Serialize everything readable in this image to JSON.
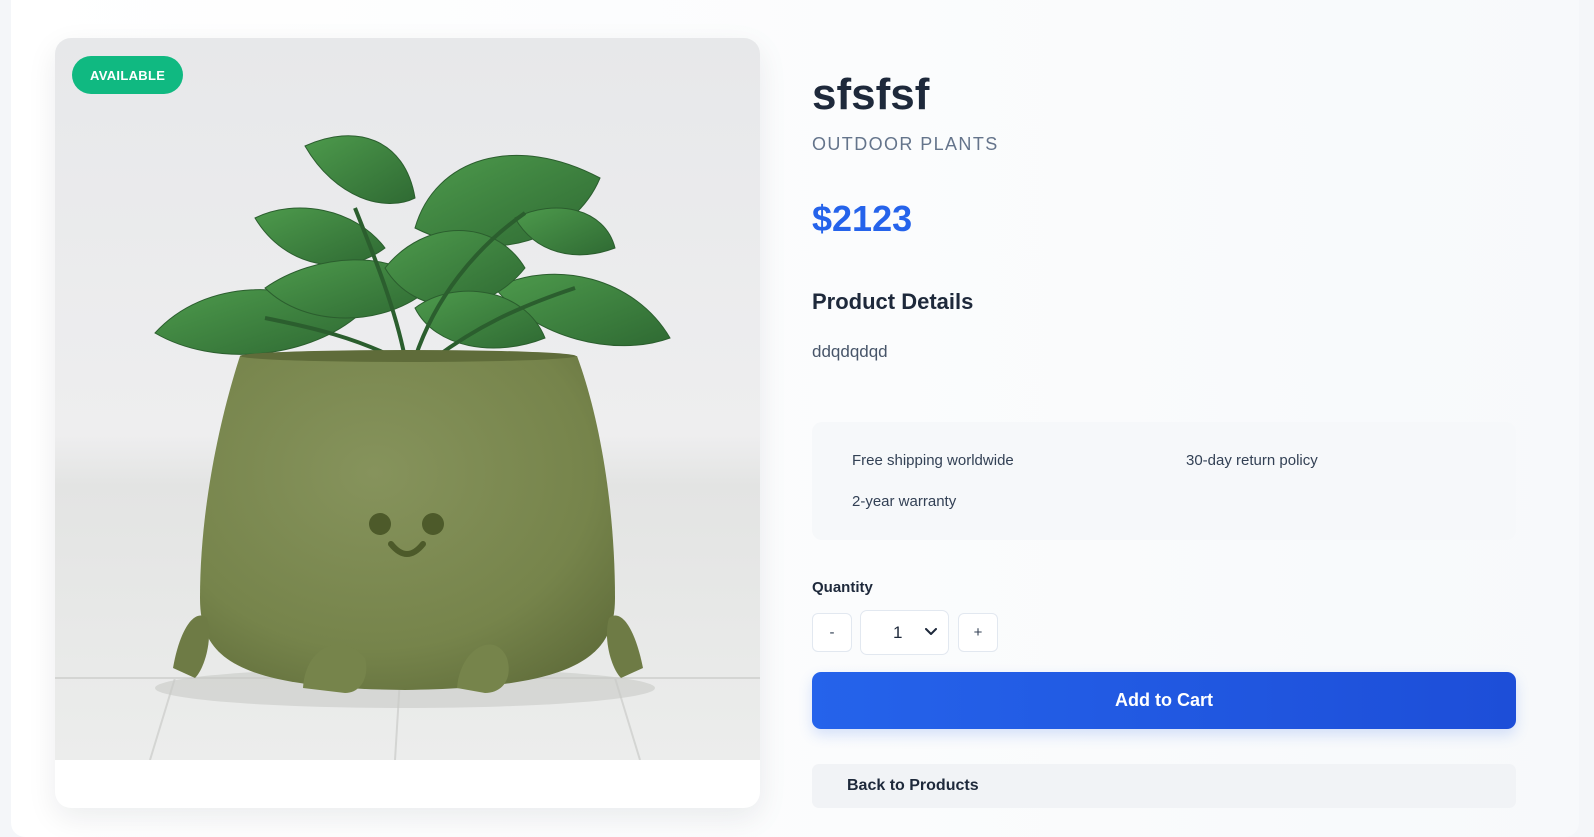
{
  "product": {
    "availability_badge": "AVAILABLE",
    "name": "sfsfsf",
    "category": "OUTDOOR PLANTS",
    "price": "$2123",
    "details_heading": "Product Details",
    "description": "ddqdqdqd",
    "image_alt": "Green smiling plant pot with leafy plant"
  },
  "features": [
    "Free shipping worldwide",
    "30-day return policy",
    "2-year warranty"
  ],
  "purchase": {
    "quantity_label": "Quantity",
    "decrement_label": "-",
    "increment_label": "+",
    "quantity_value": "1",
    "add_to_cart_label": "Add to Cart",
    "back_label": "Back to Products"
  },
  "colors": {
    "accent": "#2563eb",
    "badge": "#10b981",
    "pot": "#7c8a52",
    "leaf": "#3f7d3f"
  }
}
